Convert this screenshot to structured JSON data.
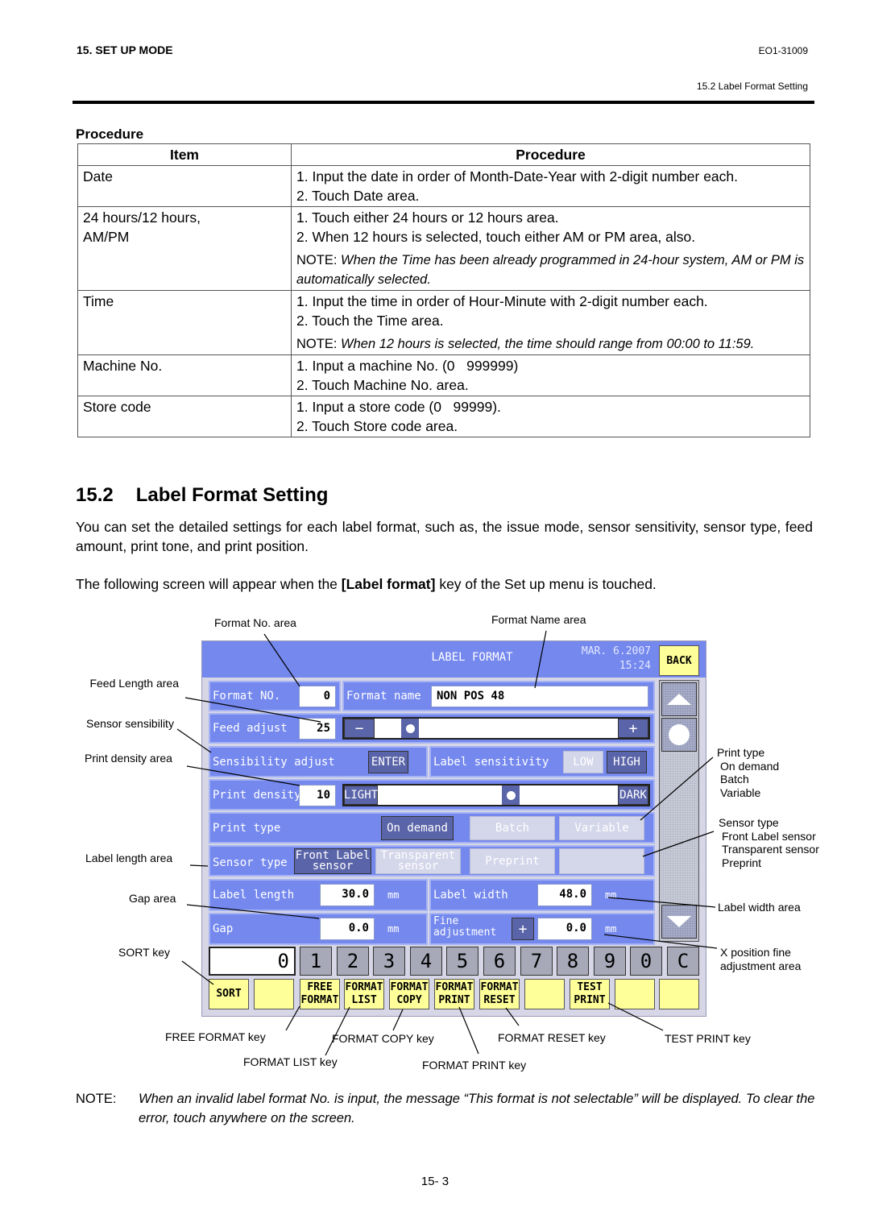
{
  "header": {
    "chapter": "15. SET UP MODE",
    "doc_id": "EO1-31009",
    "section_ref": "15.2 Label Format Setting"
  },
  "procedure": {
    "title": "Procedure",
    "columns": [
      "Item",
      "Procedure"
    ],
    "rows": [
      {
        "item": "Date",
        "steps": [
          "1. Input the date in order of Month-Date-Year with 2-digit number each.",
          "2. Touch Date area."
        ],
        "note": ""
      },
      {
        "item": "24 hours/12 hours, AM/PM",
        "steps": [
          "1. Touch either 24 hours or 12 hours area.",
          "2. When 12 hours is selected, touch either AM or PM area, also."
        ],
        "note_label": "NOTE",
        "note": "When the Time has been already programmed in 24-hour system, AM or PM is automatically selected."
      },
      {
        "item": "Time",
        "steps": [
          "1. Input the time in order of Hour-Minute with 2-digit number each.",
          "2. Touch the Time area."
        ],
        "note_label": "NOTE",
        "note": "When 12 hours is selected, the time should range from 00:00 to 11:59."
      },
      {
        "item": "Machine No.",
        "steps": [
          "1. Input a machine No. (0   999999)",
          "2. Touch Machine No. area."
        ],
        "note": ""
      },
      {
        "item": "Store code",
        "steps": [
          "1. Input a store code (0   99999).",
          "2. Touch Store code area."
        ],
        "note": ""
      }
    ]
  },
  "section": {
    "number": "15.2",
    "title": "Label Format Setting",
    "para1": "You can set the detailed settings for each label format, such as, the issue mode, sensor sensitivity, sensor type, feed amount, print tone, and print position.",
    "para2_pre": "The following screen will appear when the ",
    "para2_bold": "[Label format]",
    "para2_post": " key of the Set up menu is touched."
  },
  "callouts": {
    "format_no_area": "Format No. area",
    "format_name_area": "Format Name area",
    "feed_length_area": "Feed Length area",
    "sensor_sensibility": "Sensor sensibility",
    "print_density_area": "Print density area",
    "label_length_area": "Label length area",
    "gap_area": "Gap area",
    "sort_key": "SORT key",
    "print_type": [
      "Print type",
      "On demand",
      "Batch",
      "Variable"
    ],
    "sensor_type": [
      "Sensor type",
      "Front Label sensor",
      "Transparent sensor",
      "Preprint"
    ],
    "label_width_area": "Label width area",
    "x_position_fine": [
      "X position fine",
      "adjustment area"
    ],
    "free_format_key": "FREE FORMAT key",
    "format_list_key": "FORMAT LIST key",
    "format_copy_key": "FORMAT COPY key",
    "format_print_key": "FORMAT PRINT key",
    "format_reset_key": "FORMAT RESET key",
    "test_print_key": "TEST PRINT key"
  },
  "screen": {
    "title": "LABEL FORMAT",
    "date": "MAR. 6.2007",
    "time": "15:24",
    "back": "BACK",
    "format_no_label": "Format NO.",
    "format_no_value": "0",
    "format_name_label": "Format name",
    "format_name_value": "NON POS 48",
    "feed_adjust_label": "Feed adjust",
    "feed_adjust_value": "25",
    "feed_slider_position": 0.2,
    "minus": "−",
    "plus": "+",
    "sensibility_label": "Sensibility adjust",
    "enter": "ENTER",
    "label_sensitivity_label": "Label sensitivity",
    "low": "LOW",
    "high": "HIGH",
    "print_density_label": "Print density",
    "print_density_value": "10",
    "light": "LIGHT",
    "dark": "DARK",
    "density_slider_position": 0.55,
    "print_type_label": "Print type",
    "print_types": [
      "On demand",
      "Batch",
      "Variable"
    ],
    "print_type_selected": "On demand",
    "sensor_type_label": "Sensor type",
    "sensor_types": [
      "Front Label sensor",
      "Transparent sensor",
      "Preprint",
      ""
    ],
    "sensor_type_selected": "Front Label sensor",
    "label_length_label": "Label length",
    "label_length_value": "30.0",
    "label_width_label": "Label width",
    "label_width_value": "48.0",
    "gap_label": "Gap",
    "gap_value": "0.0",
    "fine_adj_label_1": "Fine",
    "fine_adj_label_2": "adjustment",
    "fine_adj_value": "0.0",
    "unit": "mm",
    "display_value": "0",
    "numkeys": [
      "1",
      "2",
      "3",
      "4",
      "5",
      "6",
      "7",
      "8",
      "9",
      "0",
      "C"
    ],
    "fkeys": [
      {
        "l1": "SORT",
        "l2": ""
      },
      {
        "l1": "",
        "l2": ""
      },
      {
        "l1": "FREE",
        "l2": "FORMAT"
      },
      {
        "l1": "FORMAT",
        "l2": "LIST"
      },
      {
        "l1": "FORMAT",
        "l2": "COPY"
      },
      {
        "l1": "FORMAT",
        "l2": "PRINT"
      },
      {
        "l1": "FORMAT",
        "l2": "RESET"
      },
      {
        "l1": "",
        "l2": ""
      },
      {
        "l1": "TEST",
        "l2": "PRINT"
      },
      {
        "l1": "",
        "l2": ""
      },
      {
        "l1": "",
        "l2": ""
      }
    ]
  },
  "bottom_note": {
    "label": "NOTE:",
    "text": "When an invalid label format No. is input, the message “This format is not selectable” will be displayed.  To clear the error, touch anywhere on the screen."
  },
  "page_number": "15- 3"
}
